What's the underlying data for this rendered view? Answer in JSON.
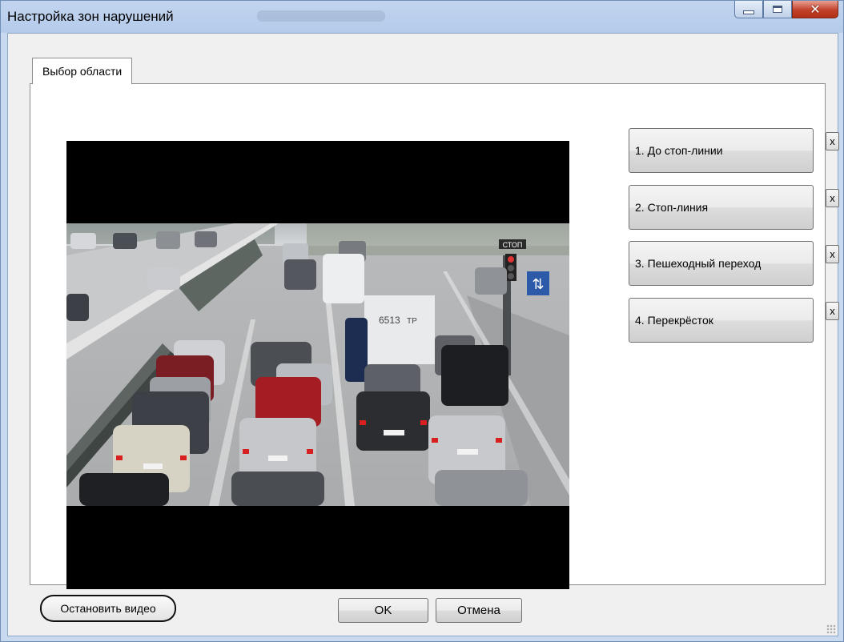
{
  "window": {
    "title": "Настройка зон нарушений"
  },
  "tabs": [
    {
      "label": "Выбор области",
      "selected": true
    }
  ],
  "video": {
    "stop_button_label": "Остановить видео",
    "scene_signs": {
      "stop_sign": "СТОП",
      "truck_text_1": "6513",
      "truck_text_2": "ТР"
    }
  },
  "zones": [
    {
      "label": "1. До стоп-линии",
      "remove_label": "x"
    },
    {
      "label": "2. Стоп-линия",
      "remove_label": "x"
    },
    {
      "label": "3. Пешеходный переход",
      "remove_label": "x"
    },
    {
      "label": "4. Перекрёсток",
      "remove_label": "x"
    }
  ],
  "footer": {
    "ok_label": "OK",
    "cancel_label": "Отмена"
  },
  "colors": {
    "window_frame": "#c9d9f0",
    "close_button": "#c2412a",
    "dialog_bg": "#f0f0f0"
  }
}
